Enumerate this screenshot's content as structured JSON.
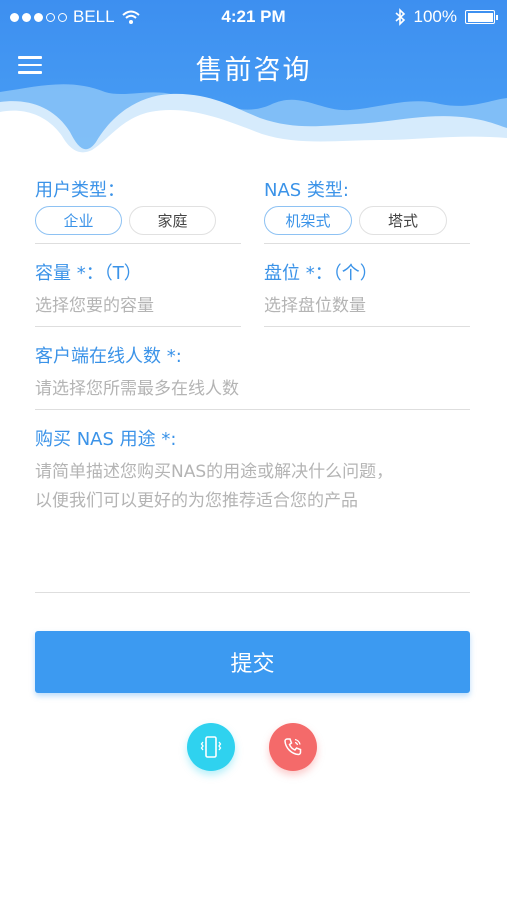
{
  "status_bar": {
    "carrier": "BELL",
    "time": "4:21 PM",
    "battery": "100%"
  },
  "nav": {
    "title": "售前咨询",
    "menu_icon": "hamburger-menu-icon"
  },
  "form": {
    "user_type": {
      "label": "用户类型：",
      "options": [
        "企业",
        "家庭"
      ],
      "selected": "企业"
    },
    "nas_type": {
      "label": "NAS 类型:",
      "options": [
        "机架式",
        "塔式"
      ],
      "selected": "机架式"
    },
    "capacity": {
      "label": "容量 *：（T）",
      "placeholder": "选择您要的容量"
    },
    "bays": {
      "label": "盘位 *：（个）",
      "placeholder": "选择盘位数量"
    },
    "online_users": {
      "label": "客户端在线人数 *:",
      "placeholder": "请选择您所需最多在线人数"
    },
    "purpose": {
      "label": "购买 NAS 用途 *:",
      "placeholder": "请简单描述您购买NAS的用途或解决什么问题，\n以便我们可以更好的为您推荐适合您的产品"
    },
    "submit_label": "提交"
  },
  "actions": {
    "left_icon": "phone-vibrate-icon",
    "right_icon": "phone-call-icon"
  },
  "colors": {
    "header_blue": "#3d8ff0",
    "accent": "#3b93e8",
    "submit": "#3c9af1",
    "cyan": "#2fd2ef",
    "red": "#f46a6a"
  }
}
